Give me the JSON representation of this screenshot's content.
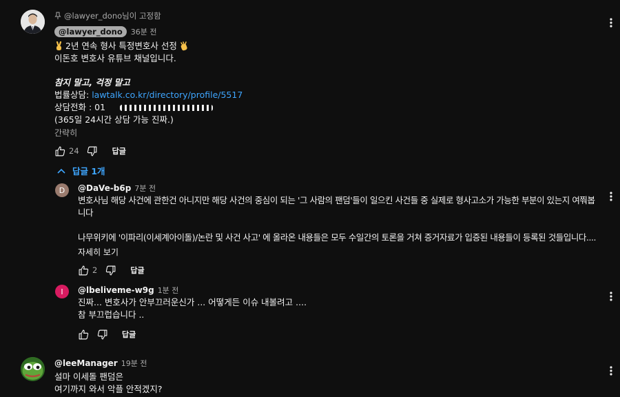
{
  "pinned": {
    "label": "@lawyer_dono님이 고정함"
  },
  "comment1": {
    "author": "@lawyer_dono",
    "time": "36분 전",
    "line1": "2년 연속 형사 특정변호사 선정",
    "line2": "이돈호 변호사 유튜브 채널입니다.",
    "line3": "참지 말고, 걱정 말고",
    "line4_prefix": "법률상담: ",
    "line4_link": "lawtalk.co.kr/directory/profile/5517",
    "line5": "상담전화 : 01",
    "line6": "(365일 24시간 상담 가능 진짜.)",
    "collapse": "간략히",
    "likes": "24",
    "reply_label": "답글",
    "replies_toggle": "답글 1개"
  },
  "reply1": {
    "avatar_letter": "D",
    "author": "@DaVe-b6p",
    "time": "7분 전",
    "line1": "변호사님 해당 사건에 관한건 아니지만 해당 사건의 중심이 되는 '그 사람의 팬덤'들이 일으킨 사건들 중 실제로 형사고소가 가능한 부분이 있는지 여쭤봅",
    "line2": "니다",
    "line3": "나무위키에 '이파리(이세계아이돌)/논란 및 사건 사고' 에 올라온 내용들은 모두 수일간의 토론을 거쳐 증거자료가 입증된 내용들이 등록된 것들입니다....",
    "more": "자세히 보기",
    "likes": "2",
    "reply_label": "답글"
  },
  "reply2": {
    "avatar_letter": "I",
    "author": "@lbeliveme-w9g",
    "time": "1분 전",
    "line1": "진짜... 변호사가 안부끄러운신가 ... 어떻게든 이슈 내볼려고 ....",
    "line2": "참 부끄럽습니다 ..",
    "reply_label": "답글"
  },
  "comment2": {
    "author": "@leeManager",
    "time": "19분 전",
    "line1": "설마 이세돌 팬덤은",
    "line2": "여기까지 와서 악플 안적겠지?"
  },
  "colors": {
    "background": "#0f0f0f",
    "link": "#3ea6ff",
    "avatar_d": "#9a7b6e",
    "avatar_i": "#d81b60"
  }
}
